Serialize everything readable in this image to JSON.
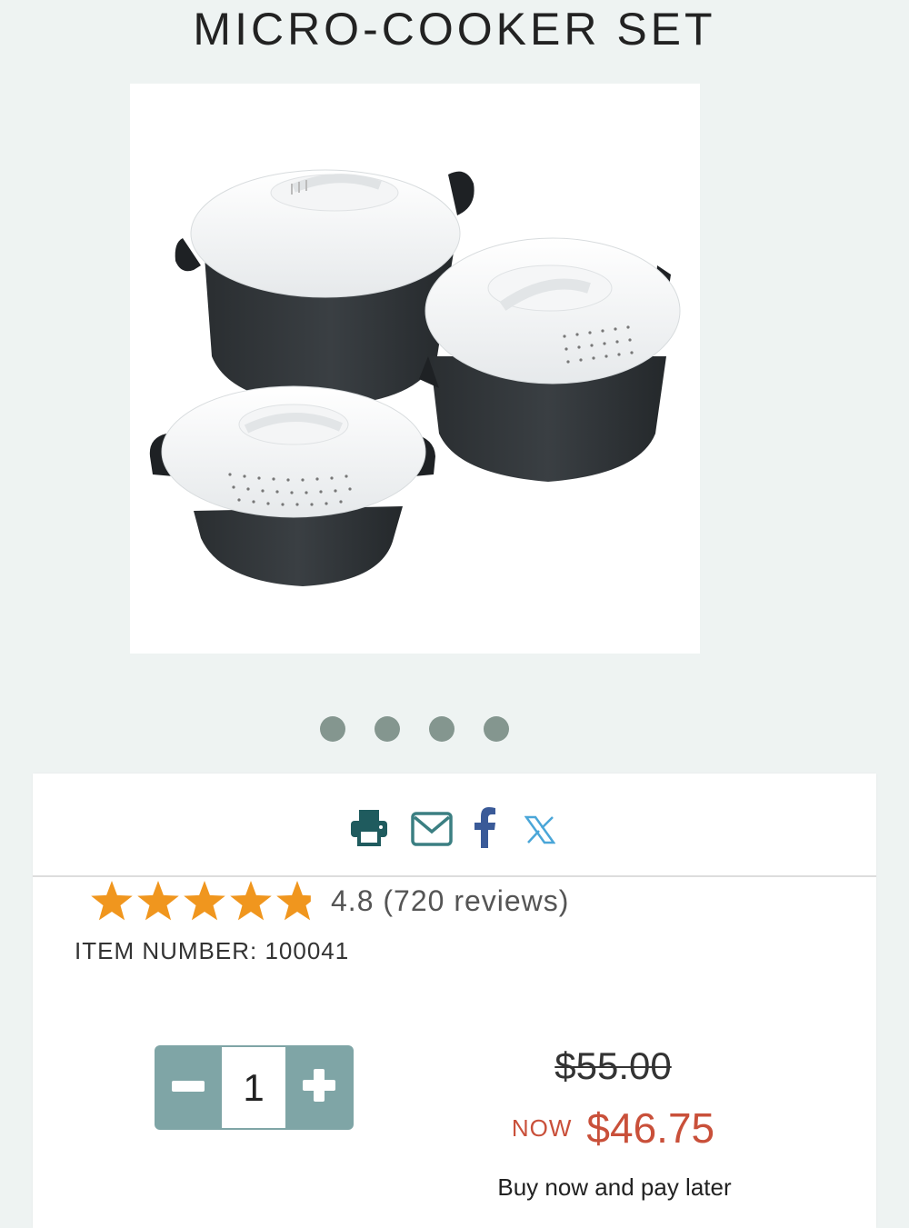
{
  "page": {
    "title": "MICRO-COOKER SET"
  },
  "gallery": {
    "slide_count": 4,
    "active_index": 0
  },
  "share": {
    "icons": [
      "print-icon",
      "email-icon",
      "facebook-icon",
      "x-icon"
    ],
    "print_color": "#1f5b5e",
    "email_color": "#3b7f82",
    "facebook_color": "#3a5a98",
    "x_color": "#4aa6d8"
  },
  "product": {
    "rating_value": "4.8",
    "rating_text": "4.8 (720 reviews)",
    "rating_fraction": 0.96,
    "star_color": "#f0961e",
    "item_number": "ITEM NUMBER: 100041",
    "quantity": "1",
    "price_original": "$55.00",
    "price_now_label": "NOW",
    "price_now": "$46.75",
    "price_color": "#c9503a",
    "bnpl_text": "Buy now and pay later",
    "stepper_color": "#7fa5a6"
  }
}
